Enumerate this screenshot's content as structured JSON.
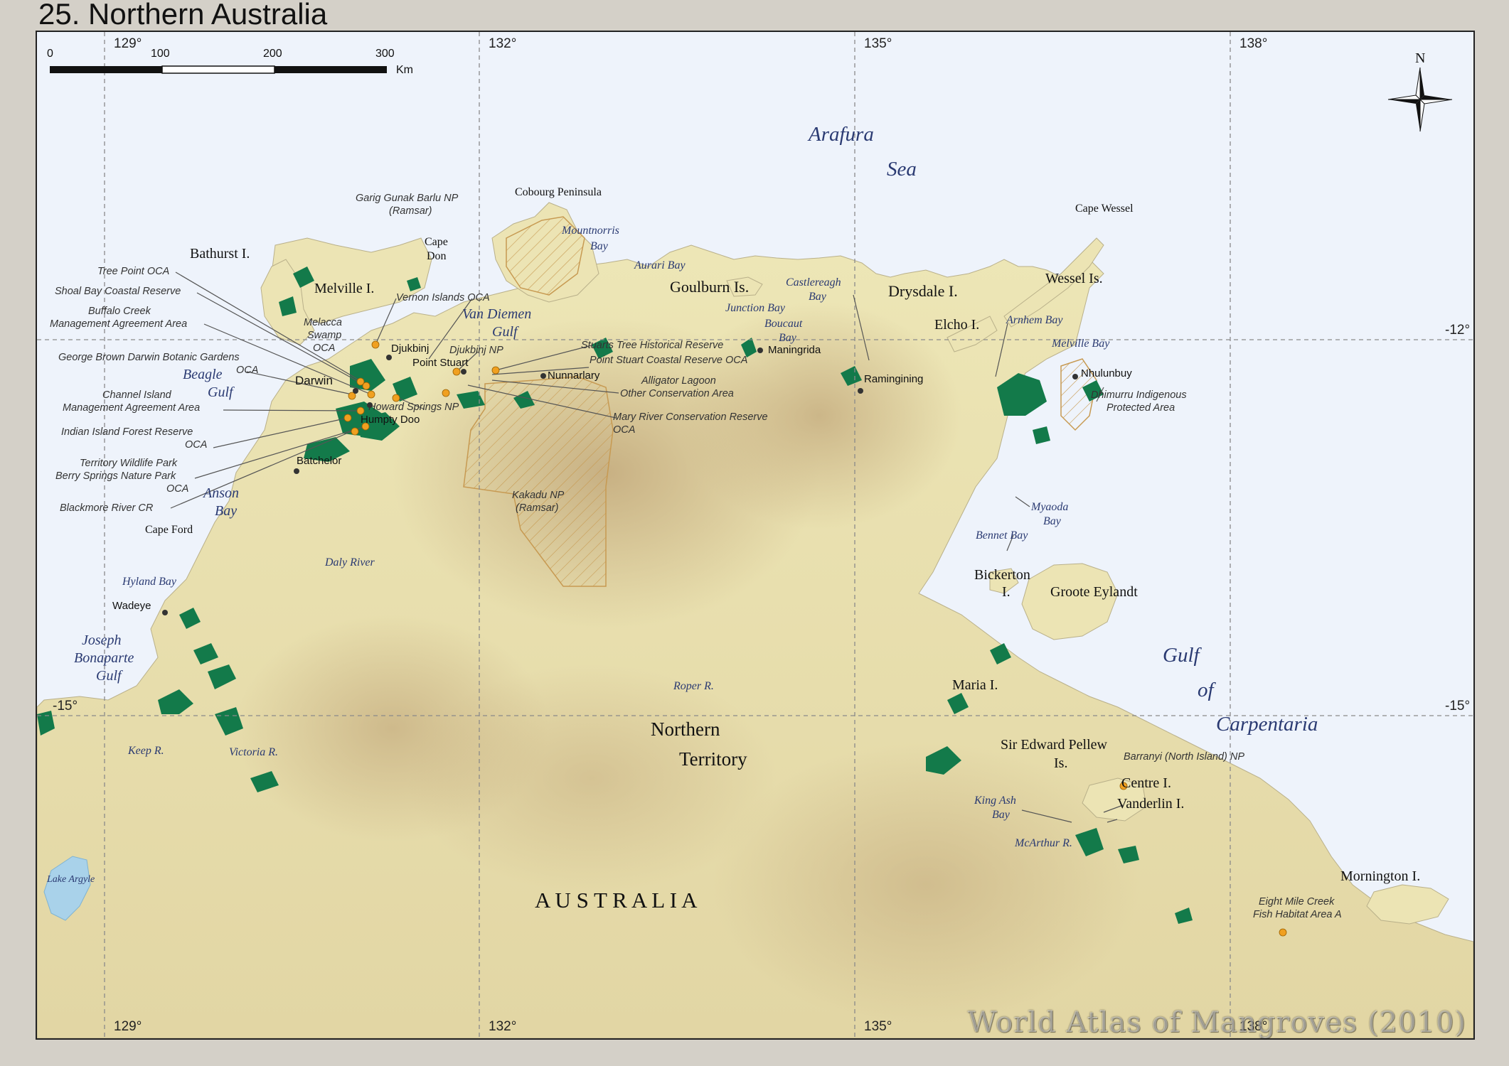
{
  "title": "25. Northern Australia",
  "watermark": "World Atlas of Mangroves (2010)",
  "colors": {
    "sea": "#eef3fb",
    "land_low": "#eae3b0",
    "land_high": "#c9b184",
    "mangrove": "#137a4a",
    "protected_hatch": "#c79a52",
    "protected_point": "#f0a020",
    "settlement": "#333333"
  },
  "scale_bar": {
    "labels": [
      "0",
      "100",
      "200",
      "300"
    ],
    "unit": "Km"
  },
  "north_arrow": {
    "label": "N",
    "icon": "compass-rose-icon"
  },
  "grid": {
    "longitudes": [
      "129°",
      "132°",
      "135°",
      "138°"
    ],
    "latitudes": [
      "-12°",
      "-15°"
    ]
  },
  "regions": {
    "country": "A U S T R A L I A",
    "state_line1": "Northern",
    "state_line2": "Territory"
  },
  "seas": {
    "arafura_1": "Arafura",
    "arafura_2": "Sea",
    "gulf_1": "Gulf",
    "gulf_2": "of",
    "gulf_3": "Carpentaria"
  },
  "islands": {
    "bathurst": "Bathurst I.",
    "melville": "Melville I.",
    "goulburn": "Goulburn Is.",
    "drysdale": "Drysdale I.",
    "wessel": "Wessel Is.",
    "elcho": "Elcho I.",
    "bickerton_1": "Bickerton",
    "bickerton_2": "I.",
    "groote": "Groote Eylandt",
    "maria": "Maria I.",
    "pellew_1": "Sir Edward Pellew",
    "pellew_2": "Is.",
    "centre": "Centre I.",
    "vanderlin": "Vanderlin I.",
    "mornington": "Mornington I."
  },
  "capes": {
    "cobourg": "Cobourg Peninsula",
    "don_1": "Cape",
    "don_2": "Don",
    "wessel": "Cape Wessel",
    "ford": "Cape Ford"
  },
  "water_features": {
    "mountnorris_1": "Mountnorris",
    "mountnorris_2": "Bay",
    "aurari": "Aurari Bay",
    "van_diemen_1": "Van Diemen",
    "van_diemen_2": "Gulf",
    "junction": "Junction Bay",
    "boucaut_1": "Boucaut",
    "boucaut_2": "Bay",
    "castlereagh_1": "Castlereagh",
    "castlereagh_2": "Bay",
    "arnhem": "Arnhem Bay",
    "melville_bay": "Melville Bay",
    "beagle_1": "Beagle",
    "beagle_2": "Gulf",
    "anson_1": "Anson",
    "anson_2": "Bay",
    "daly": "Daly River",
    "hyland": "Hyland Bay",
    "jbg_1": "Joseph",
    "jbg_2": "Bonaparte",
    "jbg_3": "Gulf",
    "keep": "Keep R.",
    "victoria": "Victoria R.",
    "roper": "Roper R.",
    "myaoda_1": "Myaoda",
    "myaoda_2": "Bay",
    "bennet": "Bennet Bay",
    "king_ash_1": "King Ash",
    "king_ash_2": "Bay",
    "mcarthur": "McArthur R.",
    "argyle": "Lake Argyle"
  },
  "settlements": {
    "darwin": "Darwin",
    "djukbinj": "Djukbinj",
    "point_stuart": "Point Stuart",
    "nunnarlary": "Nunnarlary",
    "maningrida": "Maningrida",
    "ramingining": "Ramingining",
    "nhulunbuy": "Nhulunbuy",
    "humpty_doo": "Humpty Doo",
    "batchelor": "Batchelor",
    "wadeye": "Wadeye"
  },
  "protected_areas": {
    "garig_1": "Garig Gunak Barlu NP",
    "garig_2": "(Ramsar)",
    "tree_point": "Tree Point OCA",
    "shoal_bay": "Shoal Bay Coastal Reserve",
    "buffalo_1": "Buffalo Creek",
    "buffalo_2": "Management Agreement Area",
    "vernon": "Vernon Islands OCA",
    "melacca_1": "Melacca",
    "melacca_2": "Swamp",
    "melacca_3": "OCA",
    "gbdbg_1": "George Brown Darwin Botanic Gardens",
    "gbdbg_2": "OCA",
    "channel_1": "Channel Island",
    "channel_2": "Management Agreement Area",
    "indian_1": "Indian Island Forest Reserve",
    "indian_2": "OCA",
    "territory_1": "Territory Wildlife Park",
    "territory_2": "Berry Springs Nature Park",
    "territory_3": "OCA",
    "blackmore": "Blackmore River CR",
    "djukbinj_np": "Djukbinj NP",
    "stuarts_tree": "Stuarts Tree Historical Reserve",
    "point_stuart_oca": "Point Stuart Coastal Reserve OCA",
    "alligator_1": "Alligator Lagoon",
    "alligator_2": "Other Conservation Area",
    "howard": "Howard Springs NP",
    "mary_1": "Mary River Conservation Reserve",
    "mary_2": "OCA",
    "kakadu_1": "Kakadu NP",
    "kakadu_2": "(Ramsar)",
    "dhimurru_1": "Dhimurru Indigenous",
    "dhimurru_2": "Protected Area",
    "barranyi": "Barranyi (North Island) NP",
    "eight_mile_1": "Eight Mile Creek",
    "eight_mile_2": "Fish Habitat Area A"
  }
}
